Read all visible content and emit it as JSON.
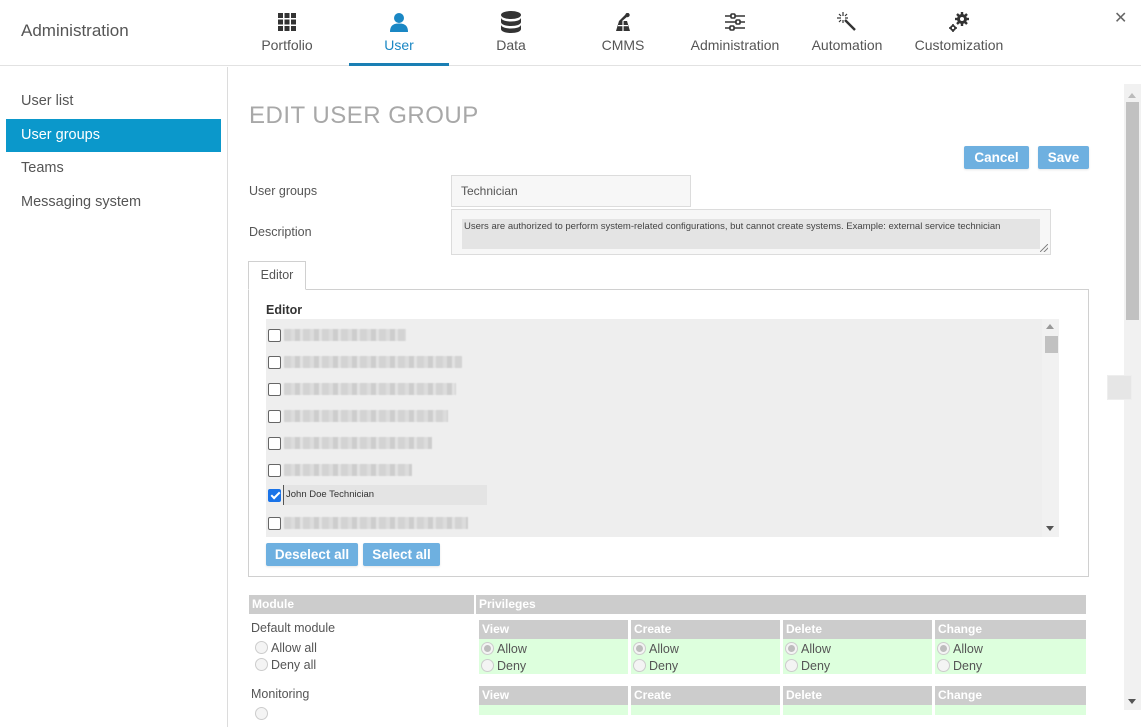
{
  "app": {
    "title": "Administration",
    "close_icon": "close-icon"
  },
  "nav": [
    {
      "label": "Portfolio",
      "icon": "grid-icon",
      "active": false
    },
    {
      "label": "User",
      "icon": "user-icon",
      "active": true
    },
    {
      "label": "Data",
      "icon": "database-icon",
      "active": false
    },
    {
      "label": "CMMS",
      "icon": "maintenance-icon",
      "active": false
    },
    {
      "label": "Administration",
      "icon": "sliders-icon",
      "active": false
    },
    {
      "label": "Automation",
      "icon": "magic-wand-icon",
      "active": false
    },
    {
      "label": "Customization",
      "icon": "gears-icon",
      "active": false
    }
  ],
  "sidebar": {
    "items": [
      {
        "label": "User list",
        "active": false
      },
      {
        "label": "User groups",
        "active": true
      },
      {
        "label": "Teams",
        "active": false
      },
      {
        "label": "Messaging system",
        "active": false
      }
    ]
  },
  "page": {
    "title": "EDIT USER GROUP",
    "cancel_label": "Cancel",
    "save_label": "Save",
    "user_groups_label": "User groups",
    "user_groups_value": "Technician",
    "description_label": "Description",
    "description_value": "Users are authorized to perform system-related configurations, but cannot create systems. Example: external service technician"
  },
  "editor_tab": {
    "tab_label": "Editor",
    "heading": "Editor",
    "users": [
      {
        "name": "[redacted]",
        "checked": false,
        "redacted": true
      },
      {
        "name": "[redacted]",
        "checked": false,
        "redacted": true
      },
      {
        "name": "[redacted]",
        "checked": false,
        "redacted": true
      },
      {
        "name": "[redacted]",
        "checked": false,
        "redacted": true
      },
      {
        "name": "[redacted]",
        "checked": false,
        "redacted": true
      },
      {
        "name": "[redacted]",
        "checked": false,
        "redacted": true
      },
      {
        "name": "John Doe Technician",
        "checked": true,
        "redacted": false
      },
      {
        "name": "[redacted]",
        "checked": false,
        "redacted": true
      }
    ],
    "deselect_all_label": "Deselect all",
    "select_all_label": "Select all"
  },
  "privileges": {
    "module_header": "Module",
    "privileges_header": "Privileges",
    "columns": [
      "View",
      "Create",
      "Delete",
      "Change"
    ],
    "allow_label": "Allow",
    "deny_label": "Deny",
    "allow_all_label": "Allow all",
    "deny_all_label": "Deny all",
    "modules": [
      {
        "name": "Default module",
        "values": [
          "Allow",
          "Allow",
          "Allow",
          "Allow"
        ],
        "all": "none"
      },
      {
        "name": "Monitoring",
        "values": [],
        "all": "none"
      }
    ],
    "allowed_bg": "#ddffdd"
  },
  "colors": {
    "accent": "#0b98cb",
    "nav_active": "#1a87c4",
    "button": "#6eb0e0",
    "header_gray": "#cccccc"
  }
}
